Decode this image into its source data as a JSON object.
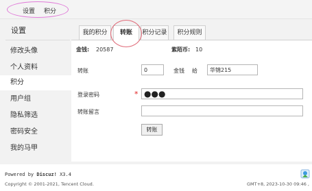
{
  "topnav": {
    "items": [
      "设置",
      "积分"
    ]
  },
  "sidebar": {
    "title": "设置",
    "items": [
      "修改头像",
      "个人资料",
      "积分",
      "用户组",
      "隐私筛选",
      "密码安全",
      "我的马甲"
    ]
  },
  "tabs": [
    "我的积分",
    "转账",
    "积分记录",
    "积分规则"
  ],
  "summary": {
    "gold_label": "金钱:",
    "gold_value": "20587",
    "purple_label": "紫陌币:",
    "purple_value": "10"
  },
  "form": {
    "transfer_label": "转账",
    "amount_value": "0",
    "currency_label": "金钱",
    "to_label": "给",
    "recipient_value": "华锦215",
    "password_label": "登录密码",
    "required_mark": "*",
    "password_mask": "●●●",
    "message_label": "转账留言",
    "message_value": "",
    "submit_label": "转账"
  },
  "footer": {
    "powered_prefix": "Powered by ",
    "powered_brand": "Discuz!",
    "powered_version": " X3.4",
    "copyright": "Copyright © 2001-2021, Tencent Cloud.",
    "timestamp": "GMT+8, 2023-10-30 09:46 ,"
  }
}
